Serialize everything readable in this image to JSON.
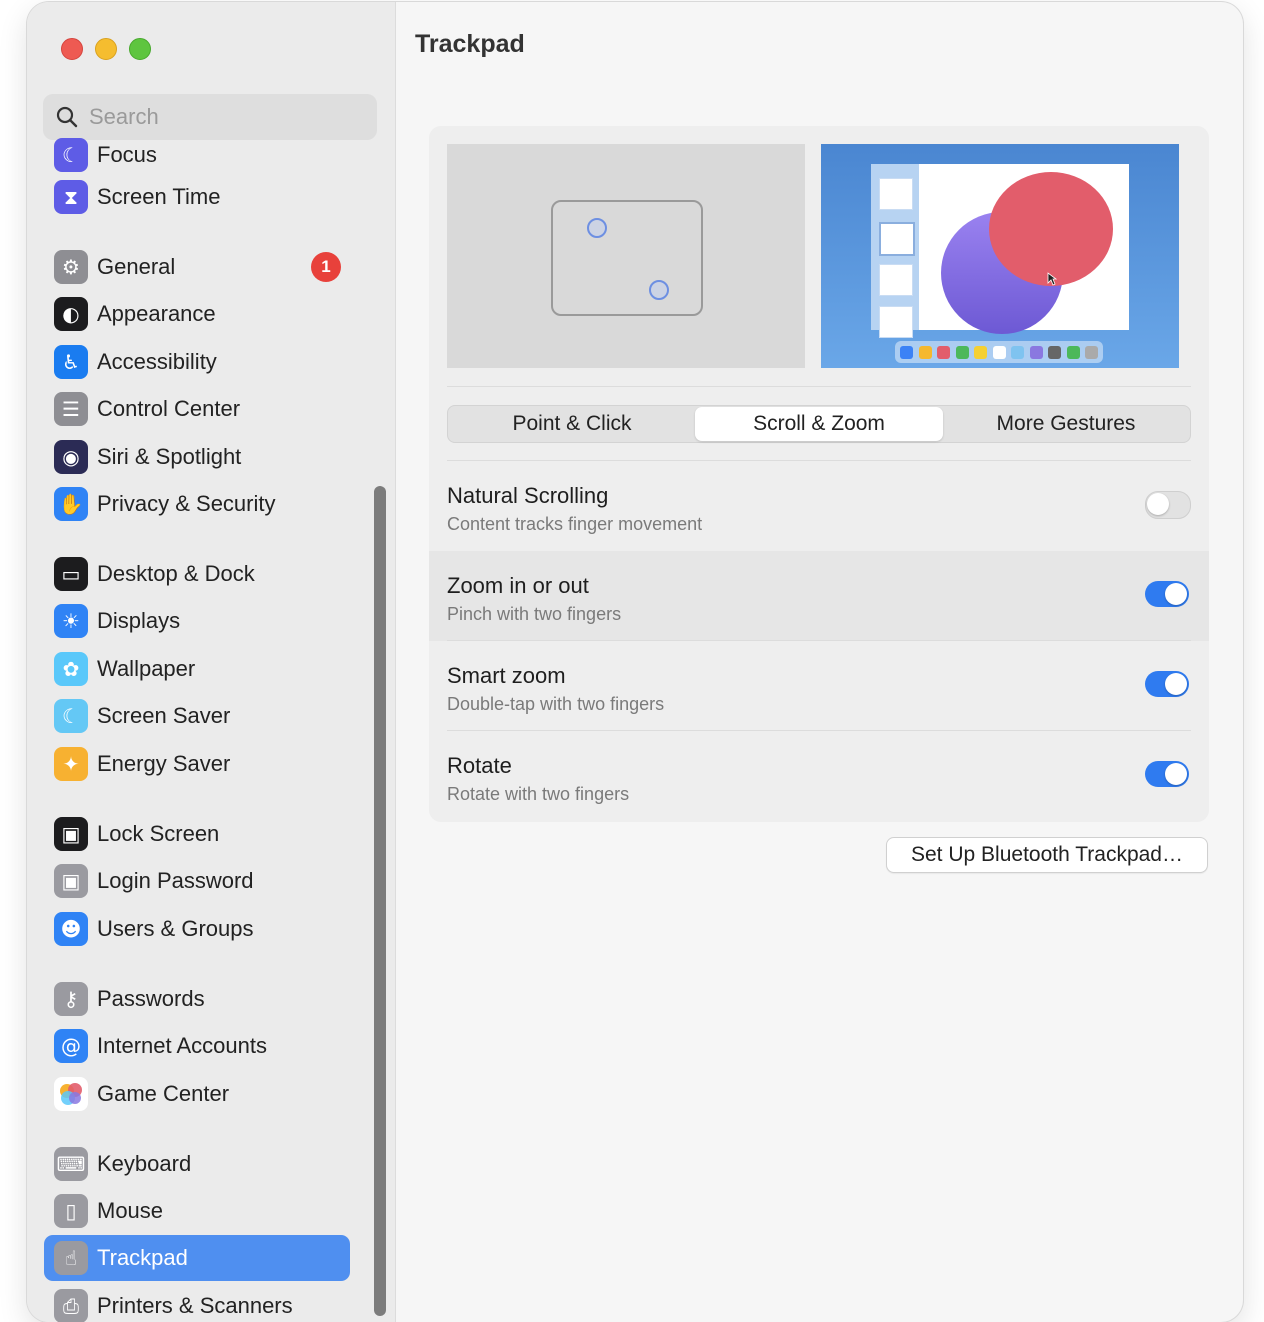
{
  "window": {
    "title": "Trackpad"
  },
  "search": {
    "placeholder": "Search"
  },
  "sidebar": {
    "items": [
      {
        "label": "Focus",
        "icon": "moon-icon",
        "color": "#5e5ce6"
      },
      {
        "label": "Screen Time",
        "icon": "hourglass-icon",
        "color": "#5e5ce6"
      },
      {
        "label": "General",
        "icon": "gear-icon",
        "color": "#8e8e93",
        "badge": "1"
      },
      {
        "label": "Appearance",
        "icon": "appearance-icon",
        "color": "#1c1c1e"
      },
      {
        "label": "Accessibility",
        "icon": "accessibility-icon",
        "color": "#1a7cf0"
      },
      {
        "label": "Control Center",
        "icon": "control-center-icon",
        "color": "#8e8e93"
      },
      {
        "label": "Siri & Spotlight",
        "icon": "siri-icon",
        "color": "#2b2b55"
      },
      {
        "label": "Privacy & Security",
        "icon": "hand-icon",
        "color": "#2f83f5"
      },
      {
        "label": "Desktop & Dock",
        "icon": "dock-icon",
        "color": "#1c1c1e"
      },
      {
        "label": "Displays",
        "icon": "sun-icon",
        "color": "#2f83f5"
      },
      {
        "label": "Wallpaper",
        "icon": "flower-icon",
        "color": "#5ac8fa"
      },
      {
        "label": "Screen Saver",
        "icon": "screen-saver-icon",
        "color": "#64c8f5"
      },
      {
        "label": "Energy Saver",
        "icon": "lightbulb-icon",
        "color": "#f7b131"
      },
      {
        "label": "Lock Screen",
        "icon": "lock-screen-icon",
        "color": "#1c1c1e"
      },
      {
        "label": "Login Password",
        "icon": "lock-icon",
        "color": "#9a9aa0"
      },
      {
        "label": "Users & Groups",
        "icon": "users-icon",
        "color": "#2f83f5"
      },
      {
        "label": "Passwords",
        "icon": "key-icon",
        "color": "#9a9aa0"
      },
      {
        "label": "Internet Accounts",
        "icon": "at-icon",
        "color": "#2f83f5"
      },
      {
        "label": "Game Center",
        "icon": "game-center-icon",
        "color": "#ffffff"
      },
      {
        "label": "Keyboard",
        "icon": "keyboard-icon",
        "color": "#9a9aa0"
      },
      {
        "label": "Mouse",
        "icon": "mouse-icon",
        "color": "#9a9aa0"
      },
      {
        "label": "Trackpad",
        "icon": "trackpad-icon",
        "color": "#9a9aa0",
        "selected": true
      },
      {
        "label": "Printers & Scanners",
        "icon": "printer-icon",
        "color": "#9a9aa0"
      }
    ]
  },
  "tabs": [
    {
      "label": "Point & Click"
    },
    {
      "label": "Scroll & Zoom",
      "active": true
    },
    {
      "label": "More Gestures"
    }
  ],
  "settings": [
    {
      "title": "Natural Scrolling",
      "subtitle": "Content tracks finger movement",
      "on": false
    },
    {
      "title": "Zoom in or out",
      "subtitle": "Pinch with two fingers",
      "on": true
    },
    {
      "title": "Smart zoom",
      "subtitle": "Double-tap with two fingers",
      "on": true
    },
    {
      "title": "Rotate",
      "subtitle": "Rotate with two fingers",
      "on": true
    }
  ],
  "bluetooth_button": "Set Up Bluetooth Trackpad…",
  "accent_color": "#2f7bf0",
  "dock_colors": [
    "#3b82f6",
    "#f5b82e",
    "#e25d6b",
    "#4cb85a",
    "#f5d033",
    "#ffffff",
    "#7fc3f0",
    "#8a78e0",
    "#666666",
    "#4cb85a",
    "#aaaaaa"
  ]
}
